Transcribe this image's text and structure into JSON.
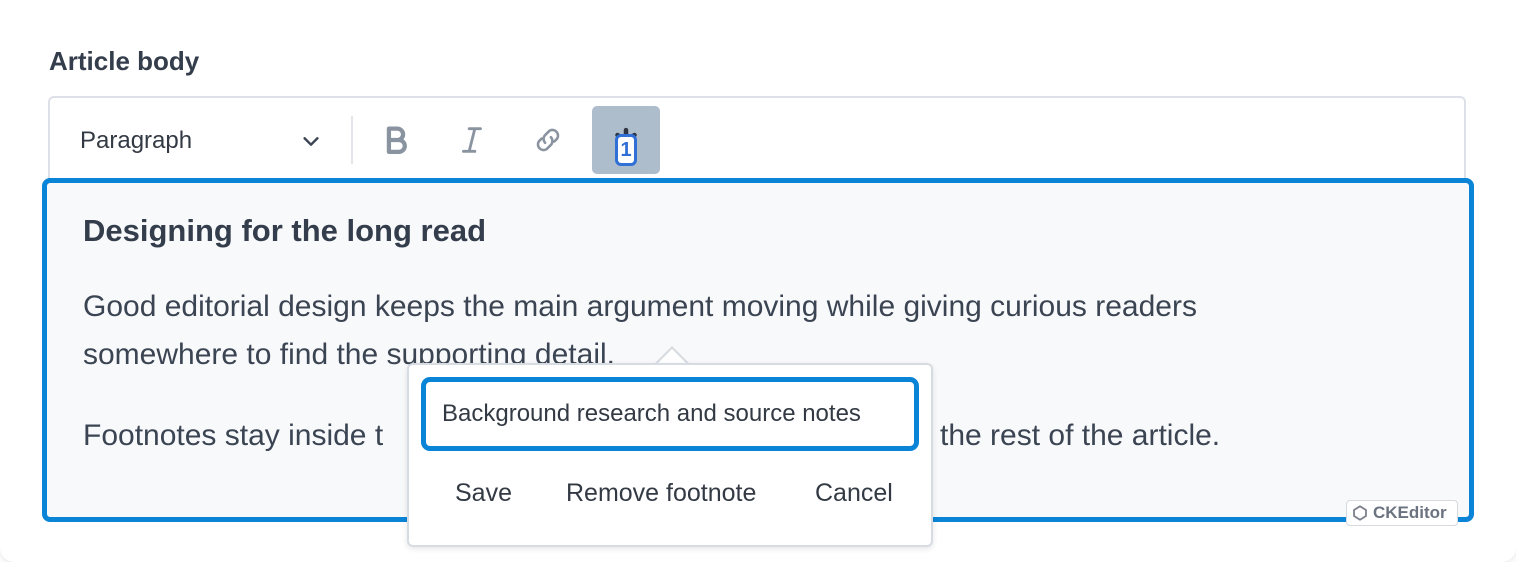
{
  "field": {
    "label": "Article body"
  },
  "toolbar": {
    "heading_select": "Paragraph",
    "buttons": [
      {
        "name": "bold",
        "icon": "bold-icon",
        "active": false
      },
      {
        "name": "italic",
        "icon": "italic-icon",
        "active": false
      },
      {
        "name": "link",
        "icon": "link-icon",
        "active": false
      },
      {
        "name": "footnote",
        "icon": "asterisk-icon",
        "active": true
      }
    ]
  },
  "document": {
    "title": "Designing for the long read",
    "paragraph1_line1": "Good editorial design keeps the main argument moving while giving curious readers",
    "paragraph1_line2": "somewhere to find the supporting detail.",
    "paragraph2_left": "Footnotes stay inside t",
    "paragraph2_right": "the rest of the article.",
    "footnote_marker": "1"
  },
  "footnote_balloon": {
    "input_value": "Background research and source notes",
    "save_label": "Save",
    "remove_label": "Remove footnote",
    "cancel_label": "Cancel"
  },
  "branding": {
    "powered_by": "CKEditor"
  },
  "colors": {
    "focus": "#0a84d6",
    "active_button": "#aebdcc",
    "marker": "#2f6fd6"
  }
}
